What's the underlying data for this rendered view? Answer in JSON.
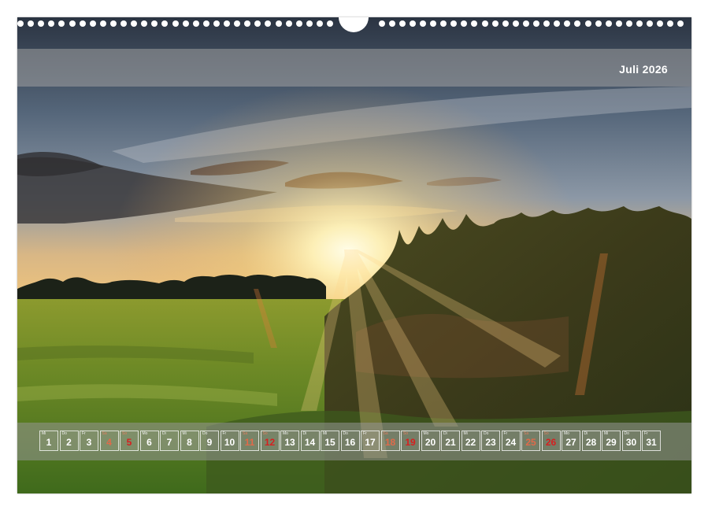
{
  "calendar": {
    "month_title": "Juli 2026",
    "days": [
      {
        "num": "1",
        "wd": "Mi",
        "type": "weekday"
      },
      {
        "num": "2",
        "wd": "Do",
        "type": "weekday"
      },
      {
        "num": "3",
        "wd": "Fr",
        "type": "weekday"
      },
      {
        "num": "4",
        "wd": "Sa",
        "type": "sat"
      },
      {
        "num": "5",
        "wd": "So",
        "type": "sun"
      },
      {
        "num": "6",
        "wd": "Mo",
        "type": "weekday"
      },
      {
        "num": "7",
        "wd": "Di",
        "type": "weekday"
      },
      {
        "num": "8",
        "wd": "Mi",
        "type": "weekday"
      },
      {
        "num": "9",
        "wd": "Do",
        "type": "weekday"
      },
      {
        "num": "10",
        "wd": "Fr",
        "type": "weekday"
      },
      {
        "num": "11",
        "wd": "Sa",
        "type": "sat"
      },
      {
        "num": "12",
        "wd": "So",
        "type": "sun"
      },
      {
        "num": "13",
        "wd": "Mo",
        "type": "weekday"
      },
      {
        "num": "14",
        "wd": "Di",
        "type": "weekday"
      },
      {
        "num": "15",
        "wd": "Mi",
        "type": "weekday"
      },
      {
        "num": "16",
        "wd": "Do",
        "type": "weekday"
      },
      {
        "num": "17",
        "wd": "Fr",
        "type": "weekday"
      },
      {
        "num": "18",
        "wd": "Sa",
        "type": "sat"
      },
      {
        "num": "19",
        "wd": "So",
        "type": "sun"
      },
      {
        "num": "20",
        "wd": "Mo",
        "type": "weekday"
      },
      {
        "num": "21",
        "wd": "Di",
        "type": "weekday"
      },
      {
        "num": "22",
        "wd": "Mi",
        "type": "weekday"
      },
      {
        "num": "23",
        "wd": "Do",
        "type": "weekday"
      },
      {
        "num": "24",
        "wd": "Fr",
        "type": "weekday"
      },
      {
        "num": "25",
        "wd": "Sa",
        "type": "sat"
      },
      {
        "num": "26",
        "wd": "So",
        "type": "sun"
      },
      {
        "num": "27",
        "wd": "Mo",
        "type": "weekday"
      },
      {
        "num": "28",
        "wd": "Di",
        "type": "weekday"
      },
      {
        "num": "29",
        "wd": "Mi",
        "type": "weekday"
      },
      {
        "num": "30",
        "wd": "Do",
        "type": "weekday"
      },
      {
        "num": "31",
        "wd": "Fr",
        "type": "weekday"
      }
    ]
  },
  "colors": {
    "saturday": "#e06a4a",
    "sunday": "#d62020",
    "title_text": "#ffffff"
  }
}
